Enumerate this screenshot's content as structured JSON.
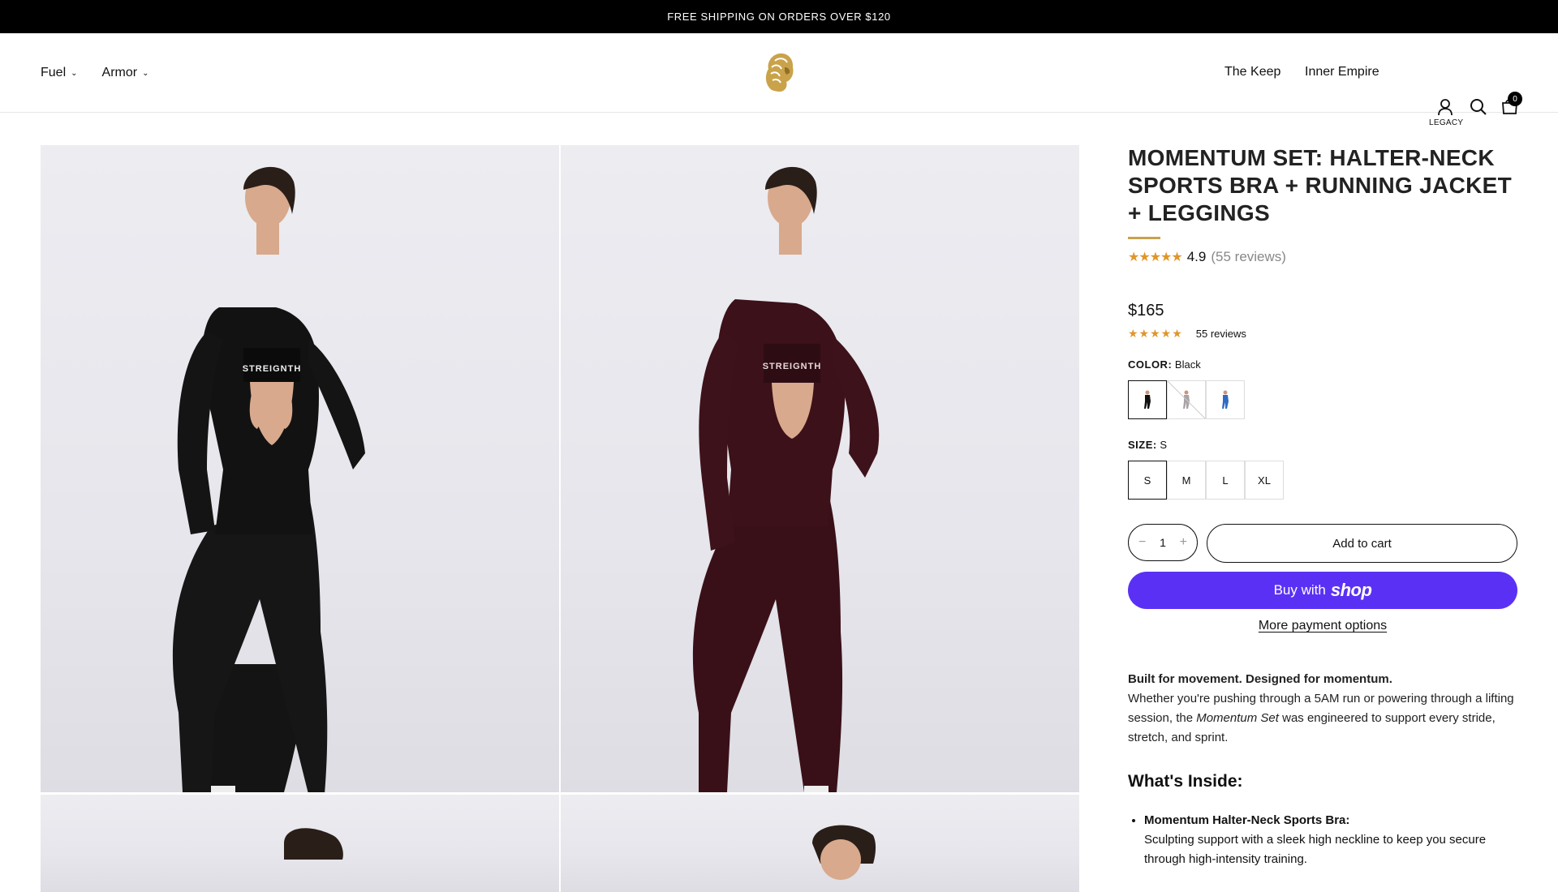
{
  "announcement": "FREE SHIPPING ON ORDERS OVER $120",
  "nav": {
    "left": [
      {
        "label": "Fuel"
      },
      {
        "label": "Armor"
      }
    ],
    "right": [
      {
        "label": "The Keep"
      },
      {
        "label": "Inner Empire"
      }
    ],
    "account_label": "LEGACY",
    "cart_count": "0",
    "icons": {
      "account": "user-icon",
      "search": "search-icon",
      "cart": "cart-icon"
    }
  },
  "gallery": {
    "photos": [
      {
        "color": "black",
        "print": "STREIGNTH"
      },
      {
        "color": "burgundy",
        "print": "STREIGNTH"
      }
    ]
  },
  "product": {
    "title": "MOMENTUM SET: HALTER-NECK SPORTS BRA + RUNNING JACKET + LEGGINGS",
    "stars": "★★★★★",
    "rating": "4.9",
    "reviews_paren": "(55 reviews)",
    "price": "$165",
    "reviews_small": "55 reviews",
    "color_label": "COLOR:",
    "color_value": "Black",
    "colors": [
      "Black",
      "Grey",
      "Blue"
    ],
    "size_label": "SIZE:",
    "size_value": "S",
    "sizes": [
      "S",
      "M",
      "L",
      "XL"
    ],
    "quantity": "1",
    "qty_minus": "−",
    "qty_plus": "+",
    "add_to_cart": "Add to cart",
    "buy_with": "Buy with",
    "shop_brand": "shop",
    "more_payment": "More payment options",
    "desc_lead": "Built for movement. Designed for momentum.",
    "desc_1": "Whether you're pushing through a 5AM run or powering through a lifting session, the ",
    "desc_em": "Momentum Set",
    "desc_2": " was engineered to support every stride, stretch, and sprint.",
    "inside_heading": "What's Inside:",
    "inside": [
      {
        "name": "Momentum Halter-Neck Sports Bra:",
        "text": "Sculpting support with a sleek high neckline to keep you secure through high-intensity training."
      }
    ]
  },
  "colors": {
    "accent_gold": "#c9a24a",
    "shop_purple": "#5a31f4",
    "star": "#e0952b"
  }
}
